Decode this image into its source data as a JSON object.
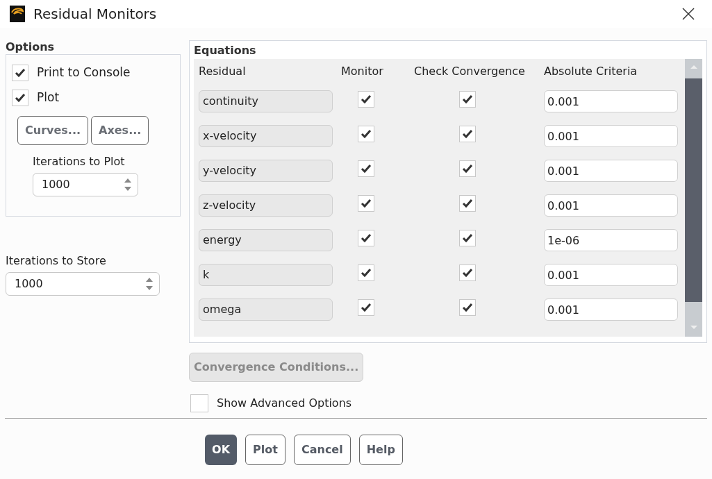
{
  "window": {
    "title": "Residual Monitors"
  },
  "options": {
    "title": "Options",
    "checkboxes": [
      {
        "label": "Print to Console",
        "checked": true
      },
      {
        "label": "Plot",
        "checked": true
      }
    ],
    "buttons": [
      "Curves...",
      "Axes..."
    ],
    "iterations_to_plot": {
      "label": "Iterations to Plot",
      "value": "1000"
    }
  },
  "iterations_to_store": {
    "label": "Iterations to Store",
    "value": "1000"
  },
  "equations": {
    "title": "Equations",
    "columns": [
      "Residual",
      "Monitor",
      "Check Convergence",
      "Absolute Criteria"
    ],
    "rows": [
      {
        "residual": "continuity",
        "monitor": true,
        "check_convergence": true,
        "criteria": "0.001"
      },
      {
        "residual": "x-velocity",
        "monitor": true,
        "check_convergence": true,
        "criteria": "0.001"
      },
      {
        "residual": "y-velocity",
        "monitor": true,
        "check_convergence": true,
        "criteria": "0.001"
      },
      {
        "residual": "z-velocity",
        "monitor": true,
        "check_convergence": true,
        "criteria": "0.001"
      },
      {
        "residual": "energy",
        "monitor": true,
        "check_convergence": true,
        "criteria": "1e-06"
      },
      {
        "residual": "k",
        "monitor": true,
        "check_convergence": true,
        "criteria": "0.001"
      },
      {
        "residual": "omega",
        "monitor": true,
        "check_convergence": true,
        "criteria": "0.001"
      }
    ]
  },
  "convergence_button": {
    "label": "Convergence Conditions...",
    "disabled": true
  },
  "advanced": {
    "label": "Show Advanced Options",
    "checked": false
  },
  "footer_buttons": [
    {
      "label": "OK",
      "kind": "primary"
    },
    {
      "label": "Plot",
      "kind": "normal"
    },
    {
      "label": "Cancel",
      "kind": "normal"
    },
    {
      "label": "Help",
      "kind": "normal"
    }
  ]
}
